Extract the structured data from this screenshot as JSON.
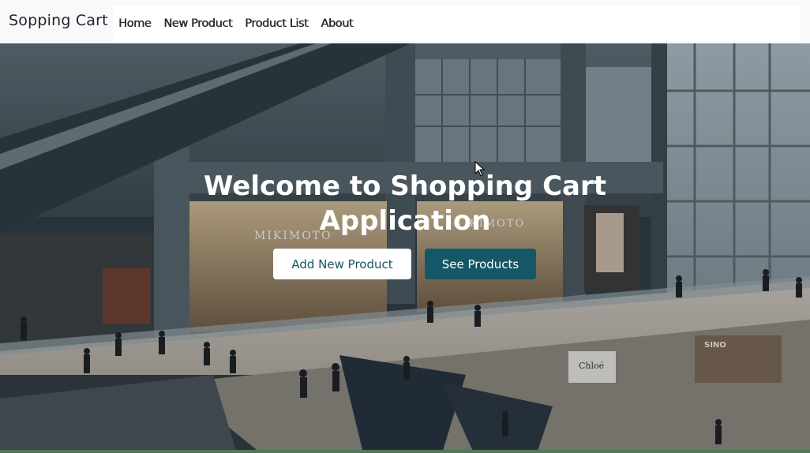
{
  "navbar": {
    "brand": "Sopping Cart",
    "links": [
      "Home",
      "New Product",
      "Product List",
      "About"
    ]
  },
  "hero": {
    "title_line1": "Welcome to Shopping Cart",
    "title_line2": "Application",
    "add_button": "Add New Product",
    "see_button": "See Products",
    "background_description_icon": "shopping-mall-photo",
    "store_sign": "MIKIMOTO",
    "store_sign2": "CASINO",
    "store_sign3": "Chloé"
  },
  "colors": {
    "navbar_bg": "#f8f9fa",
    "primary": "#155766",
    "white": "#ffffff"
  }
}
